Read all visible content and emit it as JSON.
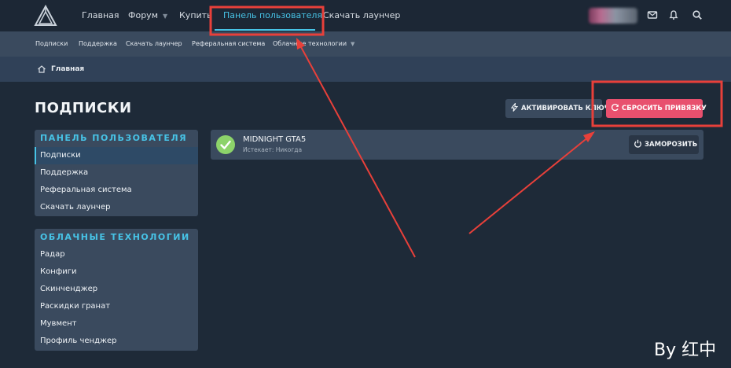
{
  "header": {
    "nav": [
      {
        "label": "Главная",
        "has_dropdown": false,
        "active": false
      },
      {
        "label": "Форум",
        "has_dropdown": true,
        "active": false
      },
      {
        "label": "Купить",
        "has_dropdown": false,
        "active": false
      },
      {
        "label": "Панель пользователя",
        "has_dropdown": false,
        "active": true
      },
      {
        "label": "Скачать лаунчер",
        "has_dropdown": false,
        "active": false
      }
    ],
    "icons": [
      "logo-triangle-icon",
      "mail-icon",
      "bell-icon",
      "search-icon"
    ]
  },
  "subnav": {
    "items": [
      {
        "label": "Подписки",
        "has_dropdown": false
      },
      {
        "label": "Поддержка",
        "has_dropdown": false
      },
      {
        "label": "Скачать лаунчер",
        "has_dropdown": false
      },
      {
        "label": "Реферальная система",
        "has_dropdown": false
      },
      {
        "label": "Облачные технологии",
        "has_dropdown": true
      }
    ]
  },
  "breadcrumb": {
    "label": "Главная",
    "icon": "home-icon"
  },
  "page": {
    "title": "ПОДПИСКИ",
    "activate_button": "АКТИВИРОВАТЬ КЛЮЧ",
    "reset_button": "СБРОСИТЬ ПРИВЯЗКУ"
  },
  "sidebar": {
    "user_panel": {
      "heading": "ПАНЕЛЬ ПОЛЬЗОВАТЕЛЯ",
      "items": [
        {
          "label": "Подписки",
          "selected": true
        },
        {
          "label": "Поддержка",
          "selected": false
        },
        {
          "label": "Реферальная система",
          "selected": false
        },
        {
          "label": "Скачать лаунчер",
          "selected": false
        }
      ]
    },
    "cloud": {
      "heading": "ОБЛАЧНЫЕ ТЕХНОЛОГИИ",
      "items": [
        {
          "label": "Радар"
        },
        {
          "label": "Конфиги"
        },
        {
          "label": "Скинченджер"
        },
        {
          "label": "Раскидки гранат"
        },
        {
          "label": "Мувмент"
        },
        {
          "label": "Профиль ченджер"
        }
      ]
    }
  },
  "subscription": {
    "name": "MIDNIGHT GTA5",
    "expires": "Истекает: Никогда",
    "freeze_button": "ЗАМОРОЗИТЬ",
    "status_icon": "check-circle-icon"
  },
  "watermark": "By 红中",
  "colors": {
    "accent": "#47c3e6",
    "reset_button": "#e8506e",
    "status_ok": "#8cd36a",
    "annotation": "#e8403a",
    "header_bg": "#1c2735",
    "panel_bg": "#3a4a5e"
  }
}
